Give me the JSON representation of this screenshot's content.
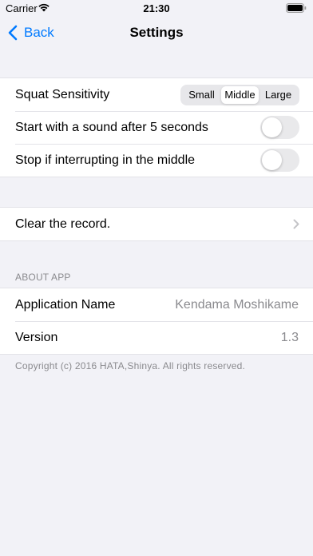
{
  "status_bar": {
    "carrier": "Carrier",
    "time": "21:30",
    "wifi_icon": "wifi-icon",
    "battery_icon": "battery-icon"
  },
  "nav": {
    "back_label": "Back",
    "back_icon": "chevron-left-icon",
    "title": "Settings"
  },
  "settings": {
    "squat_label": "Squat Sensitivity",
    "squat_options": [
      "Small",
      "Middle",
      "Large"
    ],
    "squat_selected": "Middle",
    "sound_label": "Start with a sound after 5 seconds",
    "sound_on": false,
    "stop_label": "Stop if interrupting in the middle",
    "stop_on": false
  },
  "record": {
    "clear_label": "Clear the record.",
    "chevron_icon": "chevron-right-icon"
  },
  "about": {
    "header": "ABOUT APP",
    "app_name_label": "Application Name",
    "app_name_value": "Kendama Moshikame",
    "version_label": "Version",
    "version_value": "1.3",
    "copyright": "Copyright (c) 2016 HATA,Shinya. All rights reserved."
  },
  "colors": {
    "accent": "#007aff",
    "background": "#f2f2f7",
    "secondary_text": "#8a8a8e"
  }
}
